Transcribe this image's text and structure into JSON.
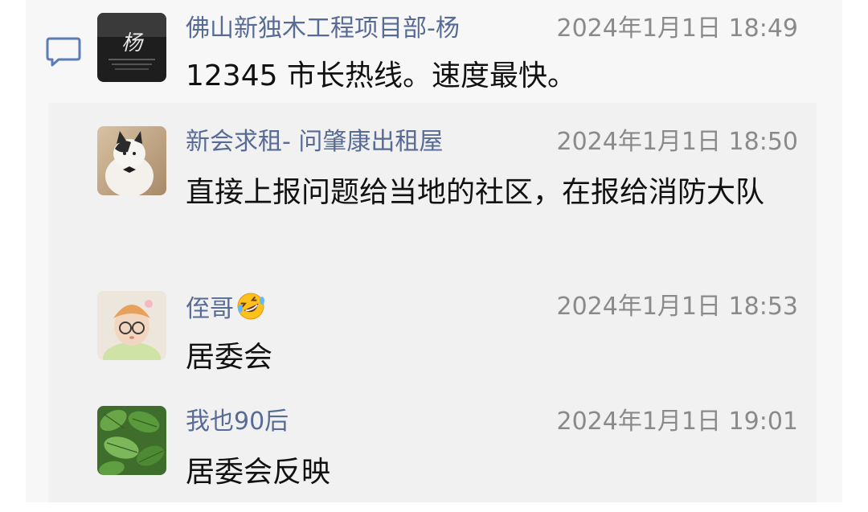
{
  "thread": {
    "messages": [
      {
        "name": "佛山新独木工程项目部-杨",
        "time": "2024年1月1日 18:49",
        "text": "12345 市长热线。速度最快。",
        "avatar": "yang-logo-avatar",
        "avatar_text": "杨"
      },
      {
        "name": "新会求租- 问肇康出租屋",
        "time": "2024年1月1日 18:50",
        "text": "直接上报问题给当地的社区，在报给消防大队",
        "avatar": "cat-avatar"
      },
      {
        "name": "侄哥",
        "time": "2024年1月1日 18:53",
        "text": "居委会",
        "avatar": "child-avatar",
        "name_emoji": "rolling-laughing-emoji"
      },
      {
        "name": "我也90后",
        "time": "2024年1月1日 19:01",
        "text": "居委会反映",
        "avatar": "green-leaves-avatar"
      }
    ]
  },
  "icons": {
    "comment": "comment-icon"
  },
  "colors": {
    "name": "#576b95",
    "time": "#8a8a8a",
    "text": "#111111",
    "thread_bg": "#f7f7f7"
  }
}
